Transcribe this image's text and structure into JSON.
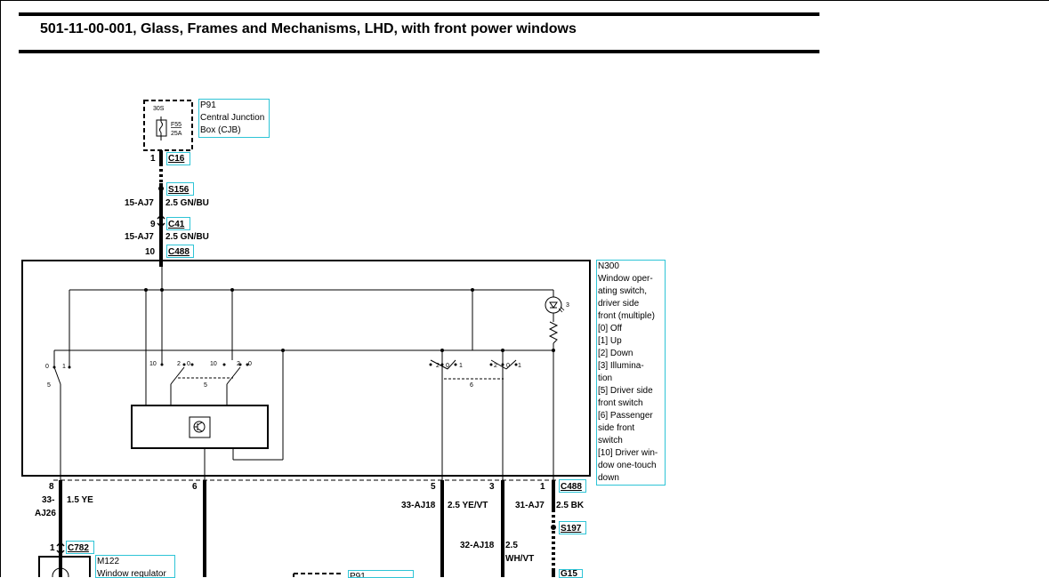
{
  "title": "501-11-00-001, Glass, Frames and Mechanisms, LHD, with front power windows",
  "p91": {
    "lines": [
      "P91",
      "Central Junction",
      "Box (CJB)"
    ],
    "term": "30S",
    "fuse": "F55",
    "amp": "25A",
    "pin": "1",
    "conn": "C16"
  },
  "s156": "S156",
  "w1": {
    "circuit": "15-AJ7",
    "spec": "2.5 GN/BU"
  },
  "c41": {
    "pin": "9",
    "conn": "C41"
  },
  "w2": {
    "circuit": "15-AJ7",
    "spec": "2.5 GN/BU"
  },
  "c488top": {
    "pin": "10",
    "conn": "C488"
  },
  "n300": {
    "lines": [
      "N300",
      "Window oper-",
      "ating switch,",
      "driver side",
      "front (multiple)",
      "[0] Off",
      "[1] Up",
      "[2] Down",
      "[3] Illumina-",
      "tion",
      "[5] Driver side",
      "front switch",
      "[6] Passenger",
      "side front",
      "switch",
      "[10] Driver win-",
      "dow one-touch",
      "down"
    ],
    "switch_labels": {
      "s5_0": "0",
      "s5_1": "1",
      "s5_num": "5",
      "a10": "10",
      "a2": "2",
      "a0": "0",
      "b10": "10",
      "b2": "2",
      "b0": "0",
      "g5": "5",
      "c2": "2",
      "c0": "0",
      "c1": "1",
      "d2": "2",
      "d0": "0",
      "d1": "1",
      "g6": "6",
      "lamp": "3"
    }
  },
  "bottom_pins": {
    "p8": "8",
    "p6": "6",
    "p5": "5",
    "p3": "3",
    "p1": "1",
    "conn": "C488"
  },
  "wire8": {
    "circuit_a": "33-",
    "circuit_b": "AJ26",
    "spec": "1.5 YE"
  },
  "wire5": {
    "circuit": "33-AJ18",
    "spec": "2.5 YE/VT"
  },
  "wire3": {
    "circuit": "32-AJ18",
    "spec_a": "2.5",
    "spec_b": "WH/VT"
  },
  "wire1": {
    "circuit": "31-AJ7",
    "spec": "2.5 BK"
  },
  "s197": "S197",
  "g15": "G15",
  "c782": {
    "pin": "1",
    "conn": "C782"
  },
  "m122": {
    "lines": [
      "M122",
      "Window regulator"
    ]
  },
  "p91b": {
    "lines": [
      "P91"
    ]
  }
}
